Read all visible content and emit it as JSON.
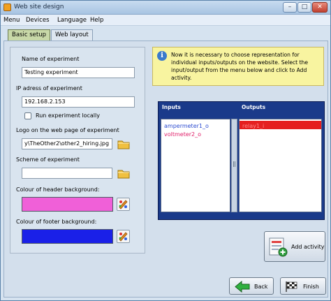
{
  "window": {
    "title": "Web site design"
  },
  "menu": [
    "Menu",
    "Devices",
    "Language",
    "Help"
  ],
  "tabs": [
    {
      "label": "Basic setup",
      "active": true
    },
    {
      "label": "Web layout",
      "active": false
    }
  ],
  "form": {
    "name_label": "Name of experiment",
    "name_value": "Testing experiment",
    "ip_label": "IP adress of experiment",
    "ip_value": "192.168.2.153",
    "run_local_label": "Run experiment locally",
    "run_local_checked": false,
    "logo_label": "Logo on the web page of experiment",
    "logo_value": "y\\TheOther2\\other2_hiring.jpg",
    "scheme_label": "Scheme of experiment",
    "scheme_value": "",
    "header_bg_label": "Colour of header background:",
    "header_bg_color": "#f060d8",
    "footer_bg_label": "Colour of footer background:",
    "footer_bg_color": "#1a20e8"
  },
  "info": {
    "text": "Now it is necessary to choose representation for individual inputs/outputs on the website. Select the input/output from the menu below and click to Add activity."
  },
  "io": {
    "inputs_label": "Inputs",
    "outputs_label": "Outputs",
    "inputs": [
      {
        "label": "ampermeter1_o",
        "color": "#2a4ad0"
      },
      {
        "label": "voltmeter2_o",
        "color": "#e0206a"
      }
    ],
    "outputs": [
      {
        "label": "relay1_i",
        "selected": true
      }
    ]
  },
  "buttons": {
    "add_activity": "Add activity",
    "back": "Back",
    "finish": "Finish"
  },
  "colors": {
    "accent_selection": "#e52020",
    "io_panel": "#1a3a8a",
    "info_bg": "#f8f4a0"
  }
}
